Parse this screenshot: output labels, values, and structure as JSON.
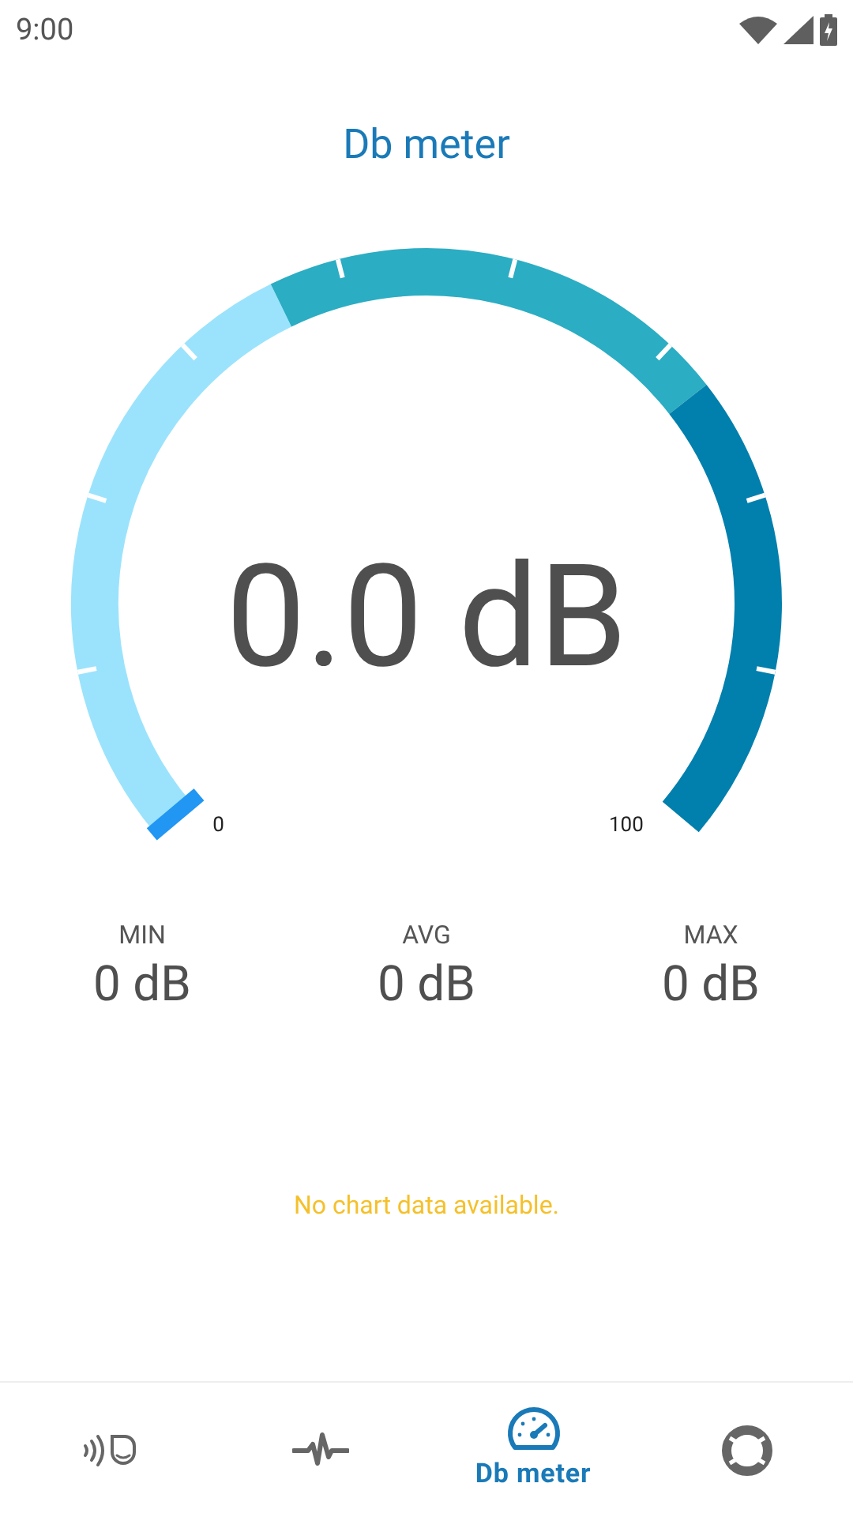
{
  "status_bar": {
    "time": "9:00"
  },
  "header": {
    "title": "Db meter"
  },
  "gauge": {
    "reading": "0.0 dB",
    "scale_min": "0",
    "scale_max": "100"
  },
  "stats": [
    {
      "label": "MIN",
      "value": "0 dB"
    },
    {
      "label": "AVG",
      "value": "0 dB"
    },
    {
      "label": "MAX",
      "value": "0 dB"
    }
  ],
  "chart_message": "No chart data available.",
  "nav": [
    {
      "kind": "sound",
      "selected": false
    },
    {
      "kind": "pulse",
      "selected": false
    },
    {
      "kind": "meter",
      "label": "Db meter",
      "selected": true
    },
    {
      "kind": "help",
      "selected": false
    }
  ]
}
